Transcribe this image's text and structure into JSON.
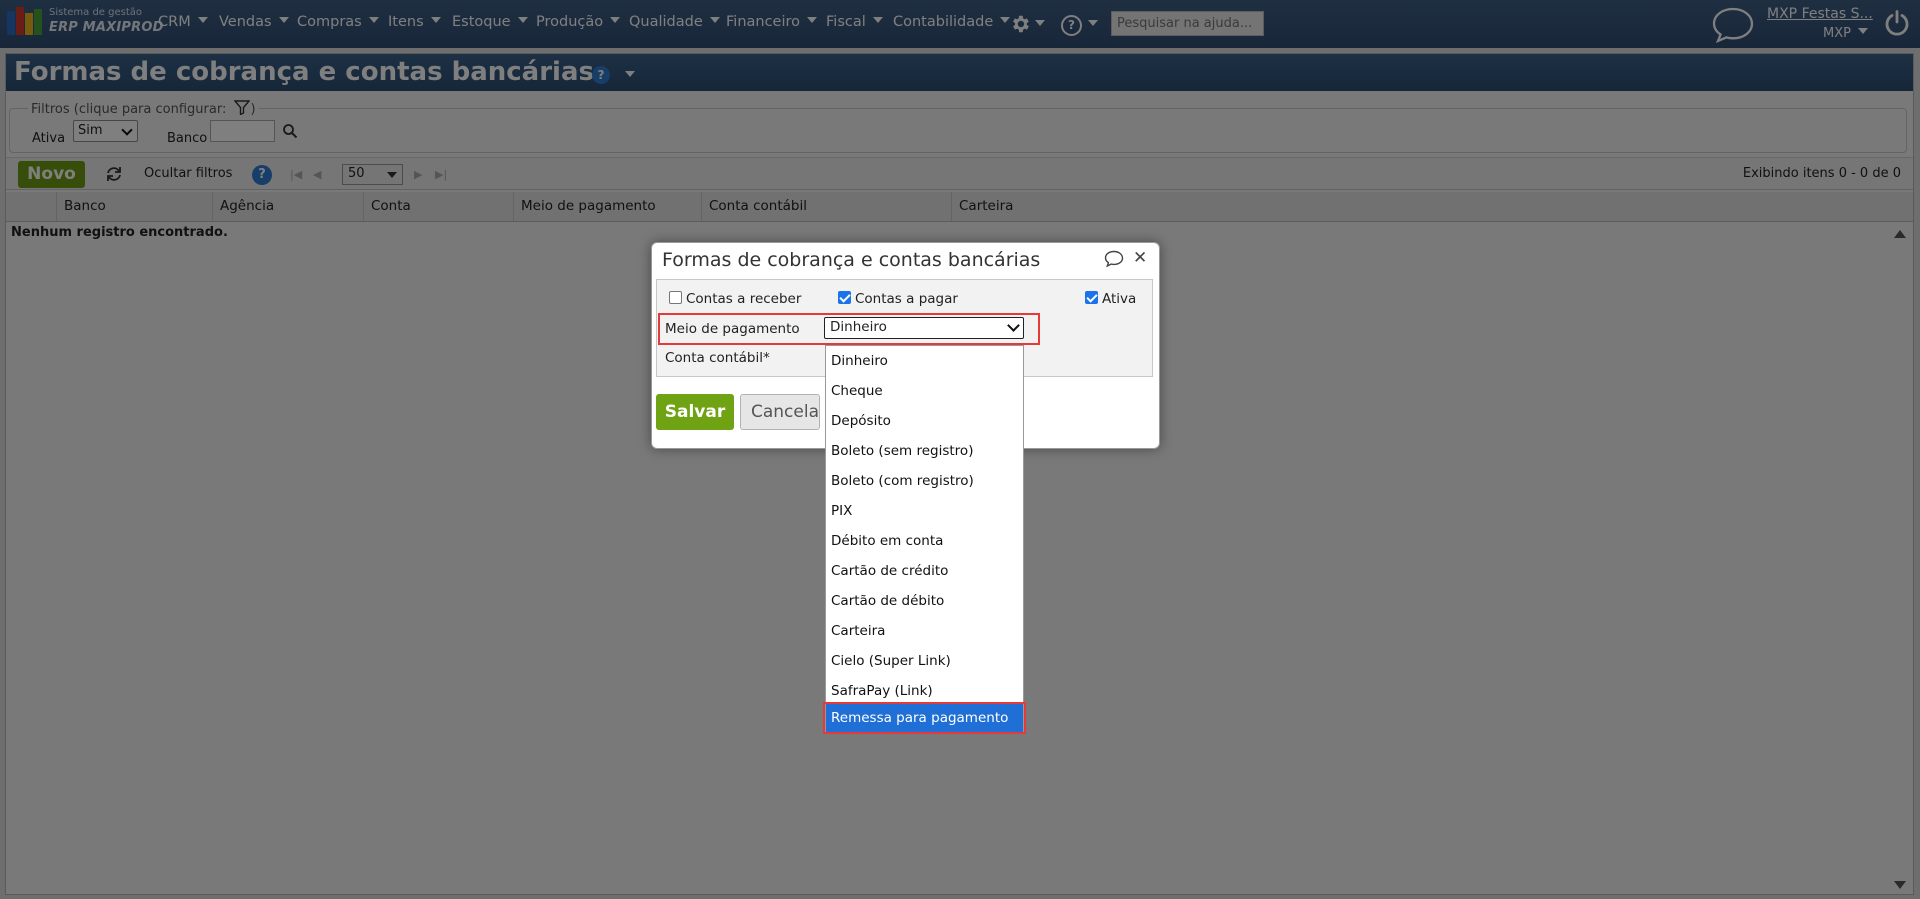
{
  "nav": {
    "brand_small": "Sistema de gestão",
    "brand_big": "ERP MAXIPROD",
    "menu": [
      "CRM",
      "Vendas",
      "Compras",
      "Itens",
      "Estoque",
      "Produção",
      "Qualidade",
      "Financeiro",
      "Fiscal",
      "Contabilidade"
    ],
    "search_placeholder": "Pesquisar na ajuda...",
    "company": "MXP Festas S...",
    "user": "MXP"
  },
  "page": {
    "title": "Formas de cobrança e contas bancárias",
    "filters_legend": "Filtros (clique para configurar:",
    "filters_legend_end": ")",
    "filter_ativa_label": "Ativa",
    "filter_ativa_value": "Sim",
    "filter_banco_label": "Banco",
    "novo_label": "Novo",
    "ocultar_label": "Ocultar filtros",
    "page_size": "50",
    "items_status": "Exibindo itens 0 - 0 de 0",
    "columns": [
      "Banco",
      "Agência",
      "Conta",
      "Meio de pagamento",
      "Conta contábil",
      "Carteira"
    ],
    "empty_message": "Nenhum registro encontrado."
  },
  "dialog": {
    "title": "Formas de cobrança e contas bancárias",
    "cb_receber": "Contas a receber",
    "cb_receber_checked": false,
    "cb_pagar": "Contas a pagar",
    "cb_pagar_checked": true,
    "cb_ativa": "Ativa",
    "cb_ativa_checked": true,
    "meio_label": "Meio de pagamento",
    "meio_value": "Dinheiro",
    "conta_contabil_label": "Conta contábil*",
    "save_label": "Salvar",
    "cancel_label": "Cancelar"
  },
  "dropdown": {
    "options": [
      "Dinheiro",
      "Cheque",
      "Depósito",
      "Boleto (sem registro)",
      "Boleto (com registro)",
      "PIX",
      "Débito em conta",
      "Cartão de crédito",
      "Cartão de débito",
      "Carteira",
      "Cielo (Super Link)",
      "SafraPay (Link)",
      "Remessa para pagamento"
    ],
    "selected": "Remessa para pagamento"
  },
  "colors": {
    "nav_bg": "#34547a",
    "accent_green": "#6fa313",
    "highlight_red": "#e63a3a",
    "selection_blue": "#1f6fd6"
  },
  "icons": [
    "erp-logo-icon",
    "gear-icon",
    "help-icon",
    "chat-icon",
    "power-icon",
    "filter-icon",
    "search-icon",
    "refresh-icon",
    "close-icon"
  ]
}
